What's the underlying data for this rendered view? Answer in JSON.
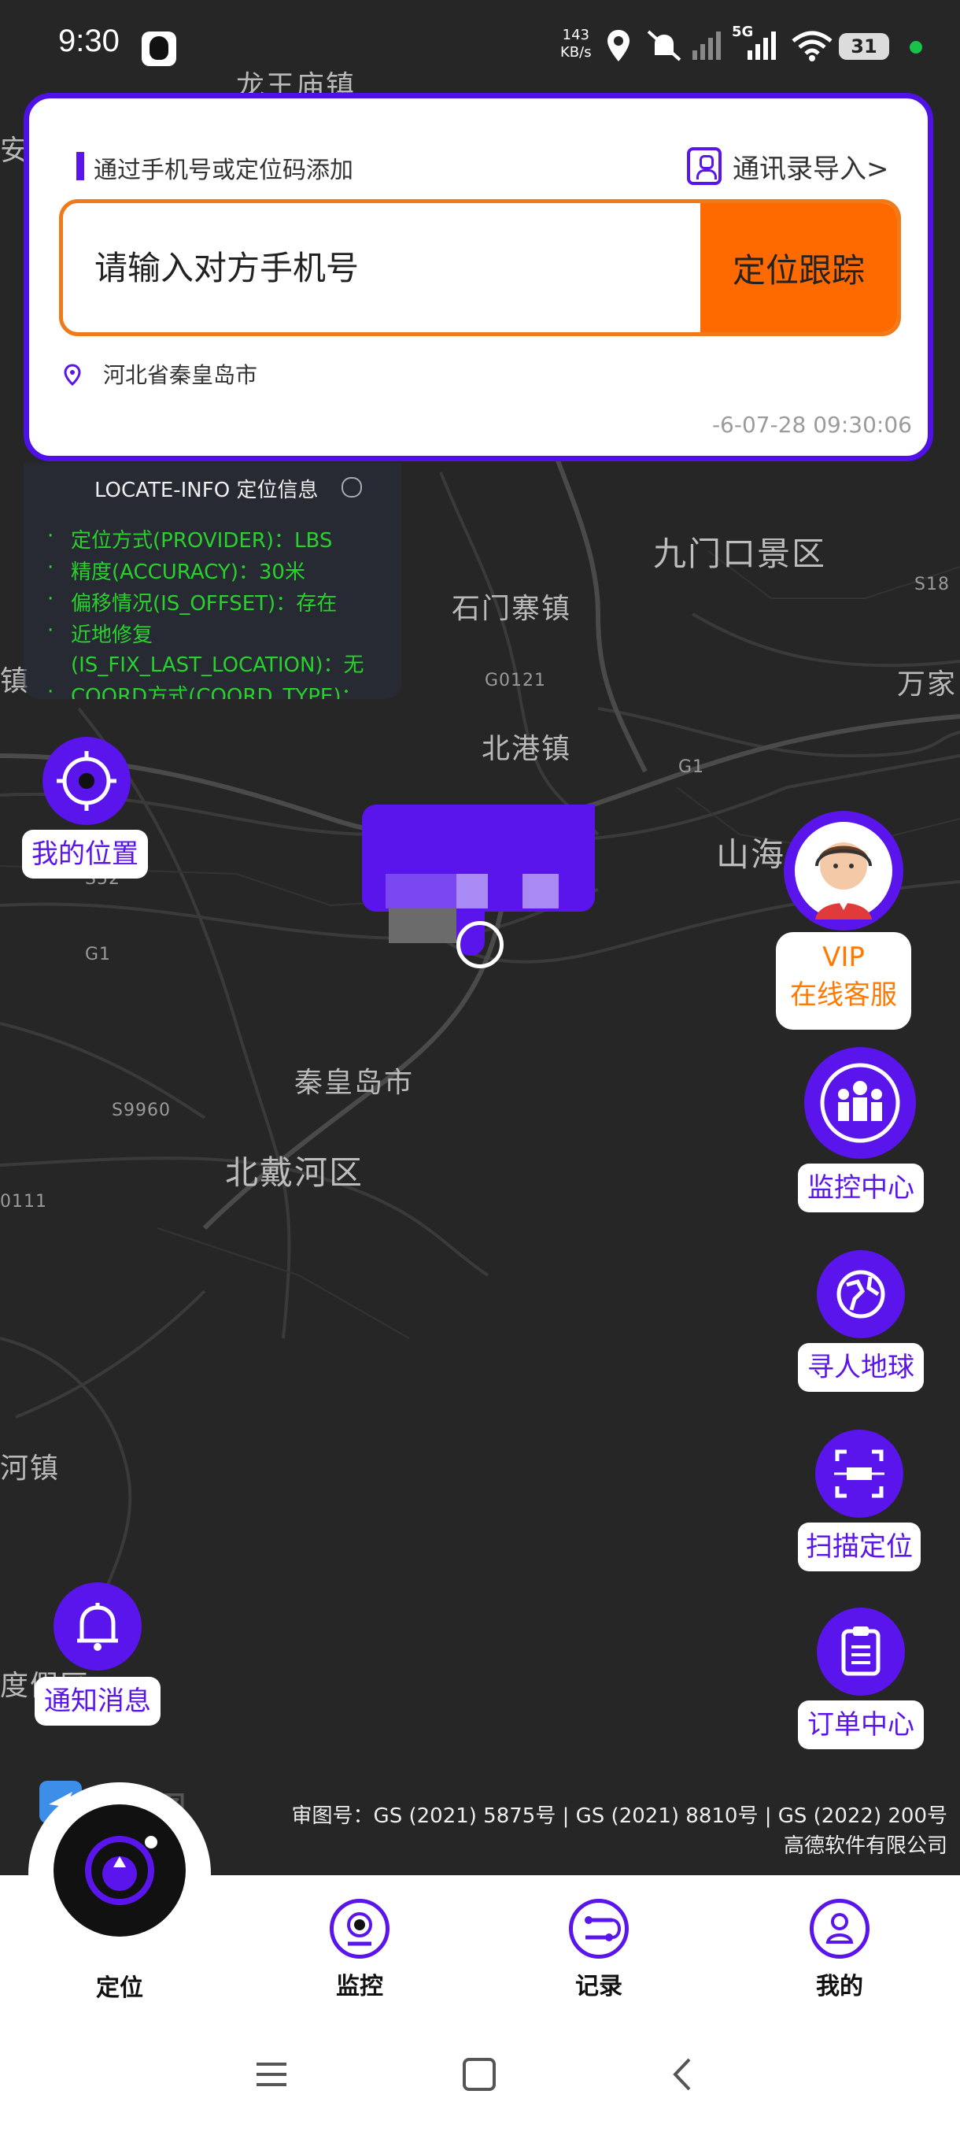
{
  "status_bar": {
    "time": "9:30",
    "net_speed_value": "143",
    "net_speed_unit": "KB/s",
    "network": "5G",
    "battery": "31"
  },
  "map": {
    "labels": {
      "longwang": "龙王庙镇",
      "an": "安",
      "jiumenkou": "九门口景区",
      "shimenzhai": "石门寨镇",
      "g0121": "G0121",
      "s18": "S18",
      "wanjia": "万家",
      "zhen_left": "镇",
      "beigang": "北港镇",
      "g1_right": "G1",
      "shanhai": "山海",
      "s52": "S52",
      "g1_left": "G1",
      "qinhuangdao": "秦皇岛市",
      "s9960": "S9960",
      "beidaihe": "北戴河区",
      "r0111": "0111",
      "hezhen": "河镇",
      "dujia": "度假区"
    },
    "provider": "高德地图",
    "copyright_line1": "审图号：GS (2021) 5875号 | GS (2021) 8810号 | GS (2022) 200号",
    "copyright_line2": "高德软件有限公司"
  },
  "top_card": {
    "tip": "通过手机号或定位码添加",
    "contacts_import": "通讯录导入>",
    "phone_placeholder": "请输入对方手机号",
    "locate_button": "定位跟踪",
    "address": "河北省秦皇岛市",
    "timestamp": "-6-07-28 09:30:06"
  },
  "locate_info": {
    "title": "LOCATE-INFO 定位信息",
    "lines": [
      "定位方式(PROVIDER)：LBS",
      "精度(ACCURACY)：30米",
      "偏移情况(IS_OFFSET)：存在",
      "近地修复",
      "(IS_FIX_LAST_LOCATION)：无",
      "COORD方式(COORD_TYPE)："
    ]
  },
  "side_buttons": {
    "my_location": "我的位置",
    "vip_line1": "VIP",
    "vip_line2": "在线客服",
    "monitor_center": "监控中心",
    "find_earth": "寻人地球",
    "scan_locate": "扫描定位",
    "order_center": "订单中心",
    "notify": "通知消息"
  },
  "bottom_nav": {
    "locate": "定位",
    "monitor": "监控",
    "records": "记录",
    "mine": "我的"
  },
  "colors": {
    "accent": "#5a14ec",
    "orange": "#ff6a00",
    "map_bg": "#262626",
    "info_green": "#29d12c"
  }
}
